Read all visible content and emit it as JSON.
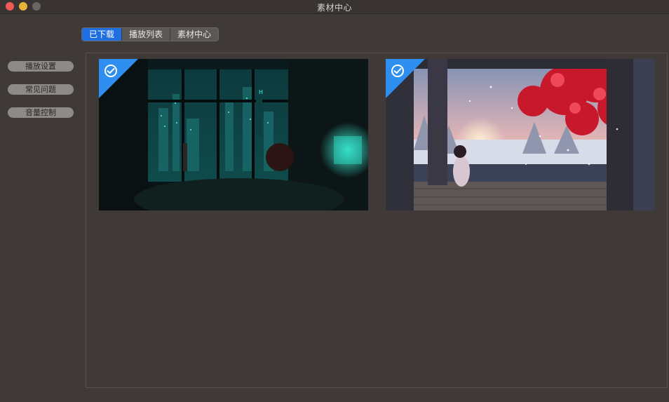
{
  "window": {
    "title": "素材中心"
  },
  "tabs": [
    {
      "label": "已下载",
      "active": true
    },
    {
      "label": "播放列表",
      "active": false
    },
    {
      "label": "素材中心",
      "active": false
    }
  ],
  "sidebar": {
    "items": [
      {
        "label": "播放设置"
      },
      {
        "label": "常见问题"
      },
      {
        "label": "音量控制"
      }
    ]
  },
  "gallery": {
    "items": [
      {
        "scene": "night-city-room",
        "downloaded": true
      },
      {
        "scene": "winter-autumn-tree",
        "downloaded": true
      }
    ]
  },
  "colors": {
    "accent": "#1f6fe0",
    "check_badge": "#2e8ff0",
    "background": "#3f3a37"
  }
}
